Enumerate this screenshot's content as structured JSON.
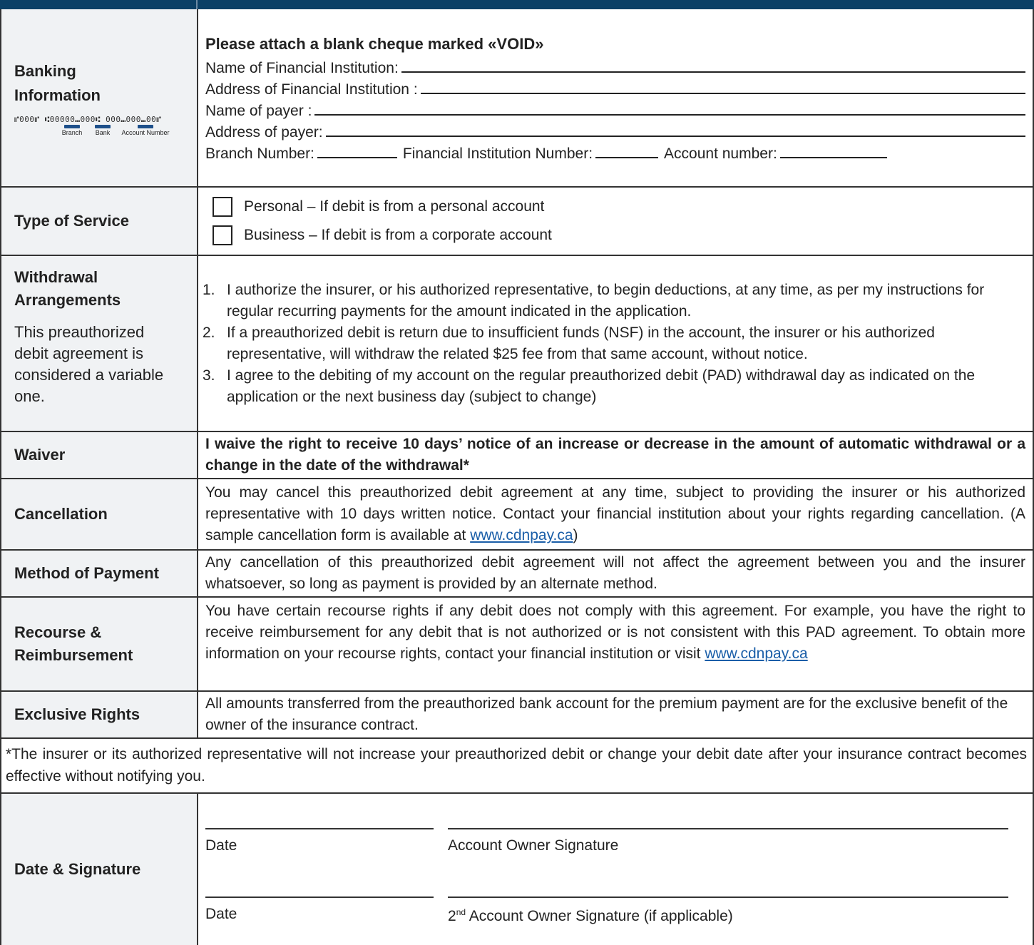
{
  "banking": {
    "label": "Banking Information",
    "micr_line": "⑈000⑈ ⑆00000⑉000⑆ 000⑉000⑉00⑈",
    "micr_branch": "Branch",
    "micr_bank": "Bank",
    "micr_account": "Account Number",
    "heading": "Please attach a blank cheque marked «VOID»",
    "field_institution_name": "Name of Financial Institution:",
    "field_institution_address": "Address of Financial Institution :",
    "field_payer_name": "Name of payer :",
    "field_payer_address": "Address of payer:",
    "field_branch_number": "Branch Number:",
    "field_institution_number": "Financial Institution Number:",
    "field_account_number": "Account number:"
  },
  "service": {
    "label": "Type of Service",
    "option_personal": "Personal – If debit is from a personal account",
    "option_business": "Business – If debit is from a corporate account"
  },
  "withdrawal": {
    "label": "Withdrawal Arrangements",
    "note": "This preauthorized debit agreement is considered a variable one.",
    "items": [
      {
        "n": "1.",
        "text": "I authorize the insurer, or his authorized representative, to begin deductions, at any time, as per my instructions for regular recurring payments for the amount indicated in the application."
      },
      {
        "n": "2.",
        "text": "If a preauthorized debit is return due to insufficient funds (NSF) in the account, the insurer or his authorized representative, will withdraw the related $25 fee from that same account, without notice."
      },
      {
        "n": "3.",
        "text": "I agree to the debiting of my account on the regular preauthorized debit (PAD) withdrawal day as indicated on the application or the next business day (subject to change)"
      }
    ]
  },
  "waiver": {
    "label": "Waiver",
    "text": "I waive the right to receive 10 days’ notice of an increase or decrease in the amount of automatic withdrawal or a change in the date of the withdrawal*"
  },
  "cancellation": {
    "label": "Cancellation",
    "text": "You may cancel this preauthorized debit agreement at any time, subject to providing the insurer or his authorized representative with 10 days written notice. Contact your financial institution about your rights regarding cancellation. (A sample cancellation form is available at ",
    "link": "www.cdnpay.ca",
    "tail": ")"
  },
  "method": {
    "label": "Method of Payment",
    "text": "Any cancellation of this preauthorized debit agreement will not affect the agreement between you and the insurer whatsoever, so long as payment is provided by an alternate method."
  },
  "recourse": {
    "label": "Recourse & Reimbursement",
    "text": "You have certain recourse rights if any debit does not comply with this agreement. For example, you have the right to receive reimbursement for any debit that is not authorized or is not consis­tent with this PAD agreement. To obtain more information on your recourse rights, contact your financial institution or visit ",
    "link": "www.cdnpay.ca"
  },
  "exclusive": {
    "label": "Exclusive Rights",
    "text": "All amounts transferred from the preauthorized bank account for the premium payment are for the exclusive benefit of the owner of the insurance contract."
  },
  "footnote": "*The insurer or its authorized representative will not increase your preauthorized debit or change your debit date after your insurance contract becomes effective without notifying you.",
  "signature": {
    "label": "Date & Signature",
    "date_label_1": "Date",
    "owner_label": "Account Owner Signature",
    "date_label_2": "Date",
    "second_owner_prefix": "2",
    "second_owner_sup": "nd",
    "second_owner_label": " Account Owner Signature (if applicable)"
  }
}
